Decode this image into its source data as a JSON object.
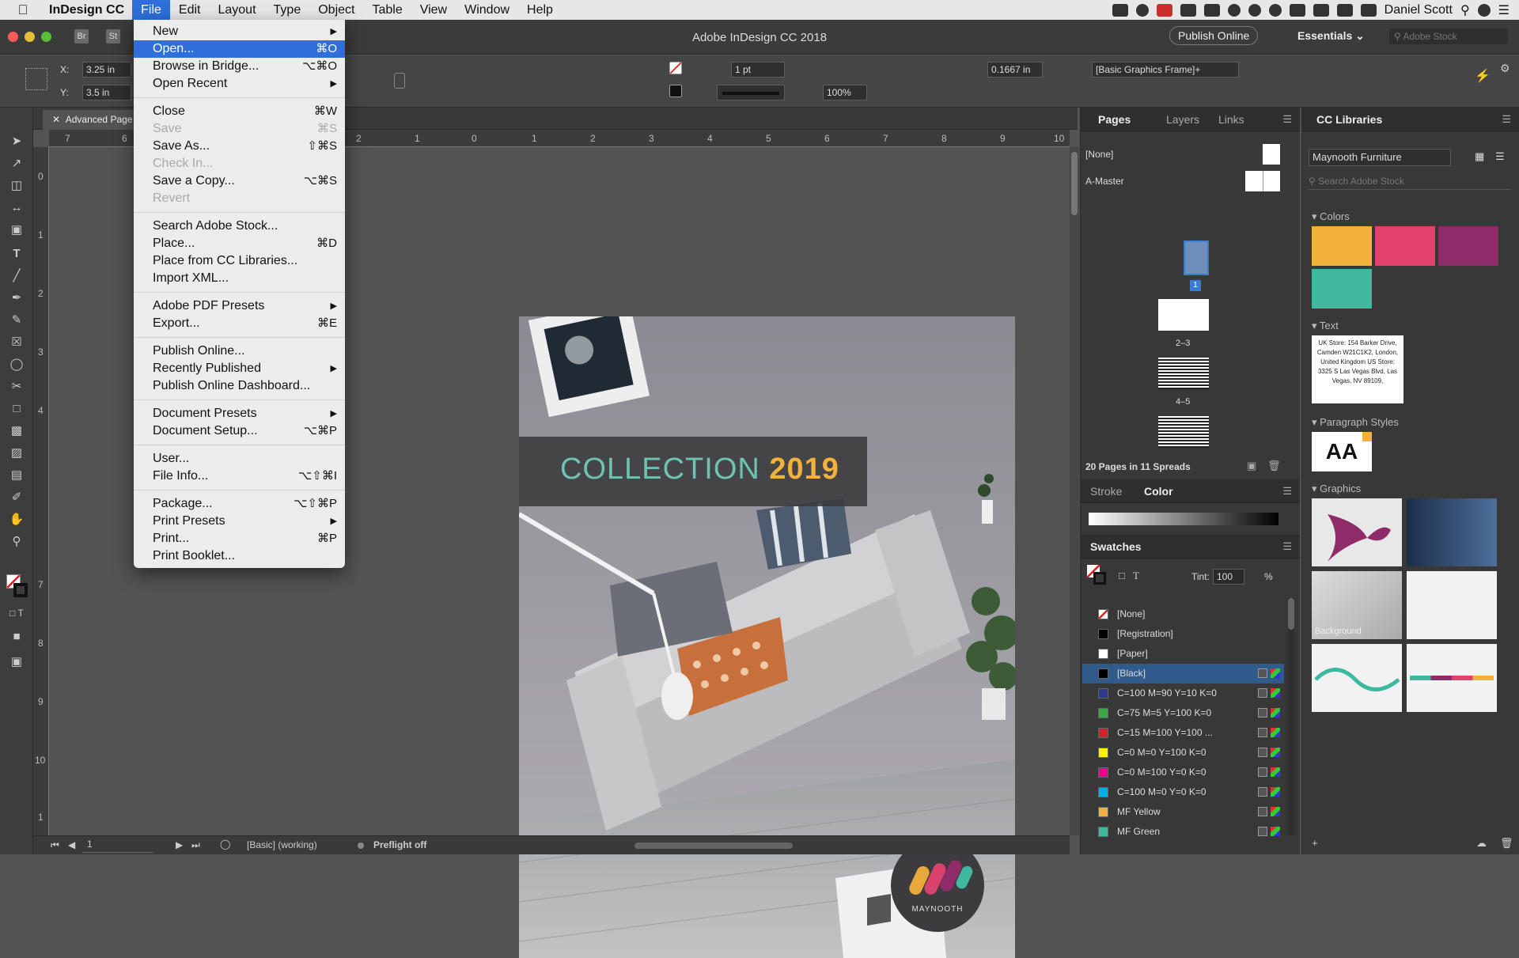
{
  "menubar": {
    "app_name": "InDesign CC",
    "items": [
      "File",
      "Edit",
      "Layout",
      "Type",
      "Object",
      "Table",
      "View",
      "Window",
      "Help"
    ],
    "user": "Daniel Scott"
  },
  "titlebar": {
    "badge_br": "Br",
    "badge_st": "St",
    "title": "Adobe InDesign CC 2018",
    "publish_btn": "Publish Online",
    "workspace": "Essentials",
    "search_placeholder": "Adobe Stock"
  },
  "control": {
    "x_label": "X:",
    "x_value": "3.25 in",
    "y_label": "Y:",
    "y_value": "3.5 in",
    "stroke_weight": "1 pt",
    "scale": "100%",
    "offset": "0.1667 in",
    "frame_style": "[Basic Graphics Frame]+"
  },
  "doc_tab": {
    "label": "Advanced Page"
  },
  "ruler_top": [
    "7",
    "6",
    "2",
    "1",
    "0",
    "1",
    "2",
    "3",
    "4",
    "5",
    "6",
    "7",
    "8",
    "9",
    "10"
  ],
  "ruler_left": [
    "0",
    "1",
    "2",
    "3",
    "4",
    "7",
    "8",
    "9",
    "10",
    "1"
  ],
  "file_menu": {
    "items": [
      {
        "label": "New",
        "shortcut": "",
        "arrow": true,
        "disabled": false,
        "selected": false
      },
      {
        "label": "Open...",
        "shortcut": "⌘O",
        "arrow": false,
        "disabled": false,
        "selected": true
      },
      {
        "label": "Browse in Bridge...",
        "shortcut": "⌥⌘O",
        "arrow": false,
        "disabled": false,
        "selected": false
      },
      {
        "label": "Open Recent",
        "shortcut": "",
        "arrow": true,
        "disabled": false,
        "selected": false
      },
      {
        "sep": true
      },
      {
        "label": "Close",
        "shortcut": "⌘W",
        "arrow": false,
        "disabled": false,
        "selected": false
      },
      {
        "label": "Save",
        "shortcut": "⌘S",
        "arrow": false,
        "disabled": true,
        "selected": false
      },
      {
        "label": "Save As...",
        "shortcut": "⇧⌘S",
        "arrow": false,
        "disabled": false,
        "selected": false
      },
      {
        "label": "Check In...",
        "shortcut": "",
        "arrow": false,
        "disabled": true,
        "selected": false
      },
      {
        "label": "Save a Copy...",
        "shortcut": "⌥⌘S",
        "arrow": false,
        "disabled": false,
        "selected": false
      },
      {
        "label": "Revert",
        "shortcut": "",
        "arrow": false,
        "disabled": true,
        "selected": false
      },
      {
        "sep": true
      },
      {
        "label": "Search Adobe Stock...",
        "shortcut": "",
        "arrow": false,
        "disabled": false,
        "selected": false
      },
      {
        "label": "Place...",
        "shortcut": "⌘D",
        "arrow": false,
        "disabled": false,
        "selected": false
      },
      {
        "label": "Place from CC Libraries...",
        "shortcut": "",
        "arrow": false,
        "disabled": false,
        "selected": false
      },
      {
        "label": "Import XML...",
        "shortcut": "",
        "arrow": false,
        "disabled": false,
        "selected": false
      },
      {
        "sep": true
      },
      {
        "label": "Adobe PDF Presets",
        "shortcut": "",
        "arrow": true,
        "disabled": false,
        "selected": false
      },
      {
        "label": "Export...",
        "shortcut": "⌘E",
        "arrow": false,
        "disabled": false,
        "selected": false
      },
      {
        "sep": true
      },
      {
        "label": "Publish Online...",
        "shortcut": "",
        "arrow": false,
        "disabled": false,
        "selected": false
      },
      {
        "label": "Recently Published",
        "shortcut": "",
        "arrow": true,
        "disabled": false,
        "selected": false
      },
      {
        "label": "Publish Online Dashboard...",
        "shortcut": "",
        "arrow": false,
        "disabled": false,
        "selected": false
      },
      {
        "sep": true
      },
      {
        "label": "Document Presets",
        "shortcut": "",
        "arrow": true,
        "disabled": false,
        "selected": false
      },
      {
        "label": "Document Setup...",
        "shortcut": "⌥⌘P",
        "arrow": false,
        "disabled": false,
        "selected": false
      },
      {
        "sep": true
      },
      {
        "label": "User...",
        "shortcut": "",
        "arrow": false,
        "disabled": false,
        "selected": false
      },
      {
        "label": "File Info...",
        "shortcut": "⌥⇧⌘I",
        "arrow": false,
        "disabled": false,
        "selected": false
      },
      {
        "sep": true
      },
      {
        "label": "Package...",
        "shortcut": "⌥⇧⌘P",
        "arrow": false,
        "disabled": false,
        "selected": false
      },
      {
        "label": "Print Presets",
        "shortcut": "",
        "arrow": true,
        "disabled": false,
        "selected": false
      },
      {
        "label": "Print...",
        "shortcut": "⌘P",
        "arrow": false,
        "disabled": false,
        "selected": false
      },
      {
        "label": "Print Booklet...",
        "shortcut": "",
        "arrow": false,
        "disabled": false,
        "selected": false
      }
    ]
  },
  "cover": {
    "title_a": "COLLECTION",
    "title_b": "2019",
    "logo_text": "MAYNOOTH"
  },
  "pages_panel": {
    "tabs": [
      "Pages",
      "Layers",
      "Links"
    ],
    "none": "[None]",
    "master": "A-Master",
    "p1": "1",
    "p23": "2–3",
    "p45": "4–5",
    "summary": "20 Pages in 11 Spreads"
  },
  "stroke_color": {
    "tabs": [
      "Stroke",
      "Color"
    ]
  },
  "swatches": {
    "title": "Swatches",
    "tint_label": "Tint:",
    "tint_value": "100",
    "percent": "%",
    "items": [
      {
        "name": "[None]",
        "color": "#ffffff"
      },
      {
        "name": "[Registration]",
        "color": "#000000"
      },
      {
        "name": "[Paper]",
        "color": "#ffffff"
      },
      {
        "name": "[Black]",
        "color": "#000000"
      },
      {
        "name": "C=100 M=90 Y=10 K=0",
        "color": "#2b3a8f"
      },
      {
        "name": "C=75 M=5 Y=100 K=0",
        "color": "#3aa645"
      },
      {
        "name": "C=15 M=100 Y=100 ...",
        "color": "#d2232a"
      },
      {
        "name": "C=0 M=0 Y=100 K=0",
        "color": "#fff200"
      },
      {
        "name": "C=0 M=100 Y=0 K=0",
        "color": "#ec008c"
      },
      {
        "name": "C=100 M=0 Y=0 K=0",
        "color": "#00aeef"
      },
      {
        "name": "MF Yellow",
        "color": "#f2b13a"
      },
      {
        "name": "MF Green",
        "color": "#3fb8a0"
      }
    ]
  },
  "libraries": {
    "title": "CC Libraries",
    "library": "Maynooth Furniture",
    "search_placeholder": "Search Adobe Stock",
    "colors_label": "Colors",
    "colors": [
      "#f2b13a",
      "#e0426b",
      "#8f2b69",
      "#3fb8a0"
    ],
    "text_label": "Text",
    "text_sample": "UK Store: 154 Barker Drive, Camden W21C1K2, London, United Kingdom US Store: 3325 S Las Vegas Blvd, Las Vegas, NV 89109,",
    "para_label": "Paragraph Styles",
    "para_sample": "AA",
    "graphics_label": "Graphics",
    "bg_label": "Background"
  },
  "status": {
    "page": "1",
    "style": "[Basic] (working)",
    "preflight": "Preflight off"
  }
}
